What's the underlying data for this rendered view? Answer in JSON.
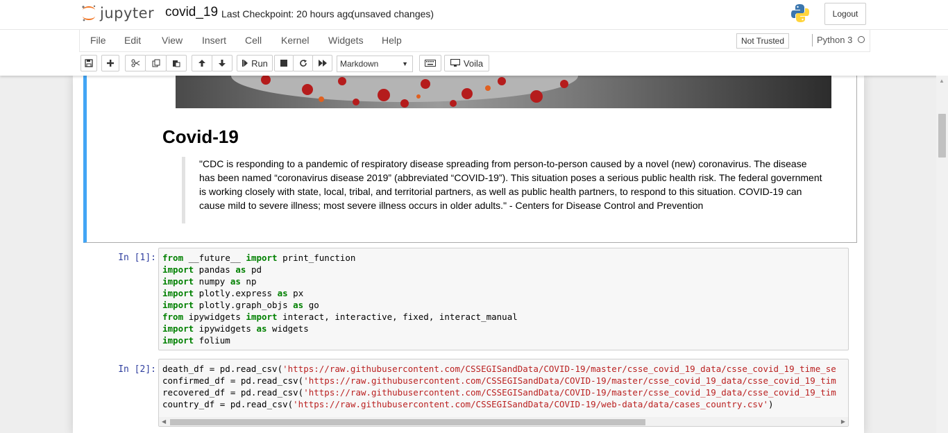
{
  "header": {
    "logo_text": "jupyter",
    "notebook_name": "covid_19",
    "checkpoint": "Last Checkpoint: 20 hours ago",
    "autosave": "(unsaved changes)",
    "logout": "Logout"
  },
  "menu": {
    "items": [
      "File",
      "Edit",
      "View",
      "Insert",
      "Cell",
      "Kernel",
      "Widgets",
      "Help"
    ],
    "trust": "Not Trusted",
    "kernel": "Python 3"
  },
  "toolbar": {
    "run_label": "Run",
    "cell_type": "Markdown",
    "voila_label": "Voila"
  },
  "markdown_cell": {
    "heading": "Covid-19",
    "quote": "\"CDC is responding to a pandemic of respiratory disease spreading from person-to-person caused by a novel (new) coronavirus. The disease has been named “coronavirus disease 2019” (abbreviated “COVID-19”). This situation poses a serious public health risk. The federal government is working closely with state, local, tribal, and territorial partners, as well as public health partners, to respond to this situation. COVID-19 can cause mild to severe illness; most severe illness occurs in older adults.\" - Centers for Disease Control and Prevention"
  },
  "cells": [
    {
      "prompt": "In [1]:",
      "lines": [
        [
          [
            "kw",
            "from"
          ],
          [
            "t",
            " __future__ "
          ],
          [
            "kw",
            "import"
          ],
          [
            "t",
            " print_function"
          ]
        ],
        [
          [
            "kw",
            "import"
          ],
          [
            "t",
            " pandas "
          ],
          [
            "kw",
            "as"
          ],
          [
            "t",
            " pd"
          ]
        ],
        [
          [
            "kw",
            "import"
          ],
          [
            "t",
            " numpy "
          ],
          [
            "kw",
            "as"
          ],
          [
            "t",
            " np"
          ]
        ],
        [
          [
            "kw",
            "import"
          ],
          [
            "t",
            " plotly.express "
          ],
          [
            "kw",
            "as"
          ],
          [
            "t",
            " px"
          ]
        ],
        [
          [
            "kw",
            "import"
          ],
          [
            "t",
            " plotly.graph_objs "
          ],
          [
            "kw",
            "as"
          ],
          [
            "t",
            " go"
          ]
        ],
        [
          [
            "kw",
            "from"
          ],
          [
            "t",
            " ipywidgets "
          ],
          [
            "kw",
            "import"
          ],
          [
            "t",
            " interact, interactive, fixed, interact_manual"
          ]
        ],
        [
          [
            "kw",
            "import"
          ],
          [
            "t",
            " ipywidgets "
          ],
          [
            "kw",
            "as"
          ],
          [
            "t",
            " widgets"
          ]
        ],
        [
          [
            "kw",
            "import"
          ],
          [
            "t",
            " folium"
          ]
        ]
      ]
    },
    {
      "prompt": "In [2]:",
      "lines": [
        [
          [
            "t",
            "death_df = pd.read_csv("
          ],
          [
            "str",
            "'https://raw.githubusercontent.com/CSSEGISandData/COVID-19/master/csse_covid_19_data/csse_covid_19_time_se"
          ]
        ],
        [
          [
            "t",
            "confirmed_df = pd.read_csv("
          ],
          [
            "str",
            "'https://raw.githubusercontent.com/CSSEGISandData/COVID-19/master/csse_covid_19_data/csse_covid_19_tim"
          ]
        ],
        [
          [
            "t",
            "recovered_df = pd.read_csv("
          ],
          [
            "str",
            "'https://raw.githubusercontent.com/CSSEGISandData/COVID-19/master/csse_covid_19_data/csse_covid_19_tim"
          ]
        ],
        [
          [
            "t",
            "country_df = pd.read_csv("
          ],
          [
            "str",
            "'https://raw.githubusercontent.com/CSSEGISandData/COVID-19/web-data/data/cases_country.csv'"
          ],
          [
            "t",
            ")"
          ]
        ]
      ]
    }
  ]
}
